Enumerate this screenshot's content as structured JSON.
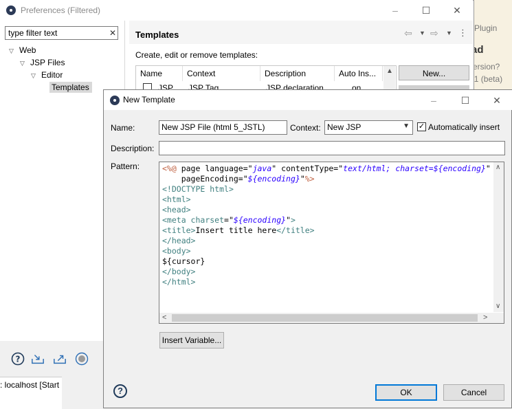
{
  "background_app": {
    "lines": [
      "Plugin",
      "ad",
      "ersion?",
      "11 (beta)"
    ]
  },
  "preferences": {
    "title": "Preferences (Filtered)",
    "filter": {
      "value": "type filter text"
    },
    "tree": [
      "Web",
      "JSP Files",
      "Editor",
      "Templates"
    ],
    "heading": "Templates",
    "description": "Create, edit or remove templates:",
    "table_columns": [
      "Name",
      "Context",
      "Description",
      "Auto Ins..."
    ],
    "table_row": [
      "JSP",
      "JSP Tag",
      "JSP declaration",
      "on"
    ],
    "new_button": "New..."
  },
  "status": {
    "text": ": localhost   [Start"
  },
  "dialog": {
    "title": "New Template",
    "name_label": "Name:",
    "name_value": "New JSP File (html 5_JSTL)",
    "context_label": "Context:",
    "context_value": "New JSP",
    "auto_insert_label": "Automatically insert",
    "auto_insert_checked": true,
    "description_label": "Description:",
    "description_value": "",
    "pattern_label": "Pattern:",
    "pattern_lines": [
      "<%@ page language=\"java\" contentType=\"text/html; charset=${encoding}\"",
      "    pageEncoding=\"${encoding}\"%>",
      "<!DOCTYPE html>",
      "<html>",
      "<head>",
      "<meta charset=\"${encoding}\">",
      "<title>Insert title here</title>",
      "</head>",
      "<body>",
      "${cursor}",
      "</body>",
      "</html>"
    ],
    "insert_variable_button": "Insert Variable...",
    "ok_button": "OK",
    "cancel_button": "Cancel"
  },
  "colors": {
    "tag": "#3f7f7f",
    "jsp_delimiter": "#bf5f3f",
    "attribute": "#7f007f",
    "value": "#2a00ff",
    "default_button_border": "#0078d7"
  }
}
